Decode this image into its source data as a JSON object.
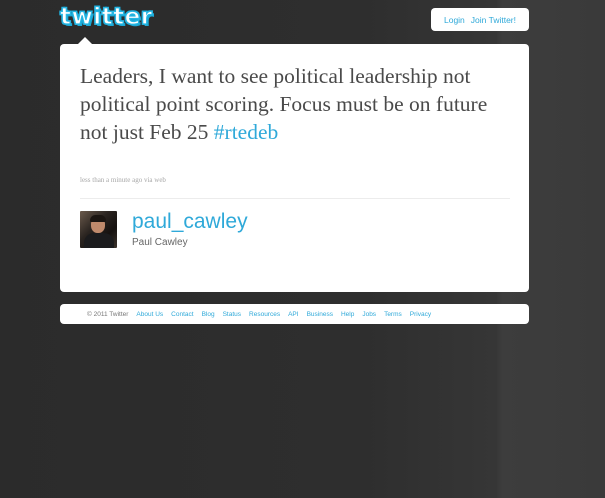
{
  "header": {
    "logo_text": "twitter",
    "login_label": "Login",
    "join_label": "Join Twitter!"
  },
  "tweet": {
    "text": "Leaders, I want to see political leadership not political point scoring. Focus must be on future not just Feb 25",
    "hashtag": "#rtedeb",
    "meta": "less than a minute ago via web"
  },
  "author": {
    "username": "paul_cawley",
    "full_name": "Paul Cawley"
  },
  "footer": {
    "copyright": "© 2011 Twitter",
    "links": [
      "About Us",
      "Contact",
      "Blog",
      "Status",
      "Resources",
      "API",
      "Business",
      "Help",
      "Jobs",
      "Terms",
      "Privacy"
    ]
  },
  "colors": {
    "accent": "#2fa9d9",
    "background": "#2b2b2b",
    "card": "#ffffff"
  }
}
